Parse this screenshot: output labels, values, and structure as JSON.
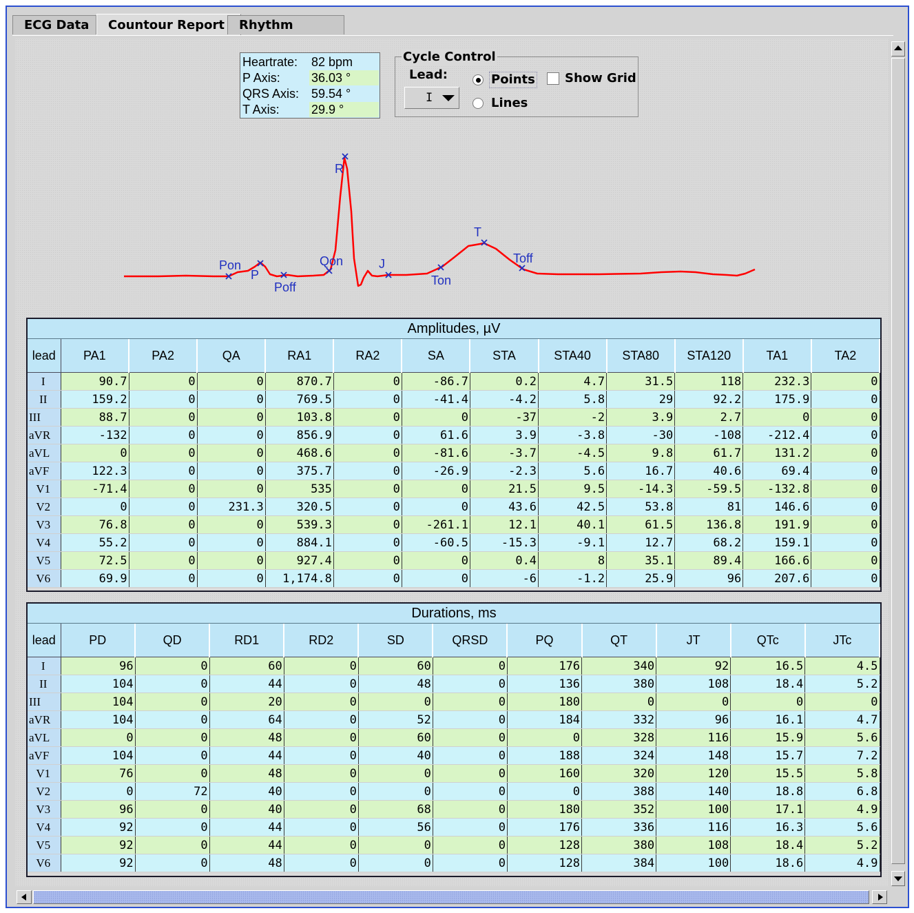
{
  "tabs": [
    {
      "label": "ECG Data",
      "active": false
    },
    {
      "label": "Countour Report",
      "active": true
    },
    {
      "label": "Rhythm Report",
      "active": false
    }
  ],
  "info": [
    {
      "key": "Heartrate:",
      "value": "82 bpm"
    },
    {
      "key": "P Axis:",
      "value": "36.03 °"
    },
    {
      "key": "QRS Axis:",
      "value": "59.54 °"
    },
    {
      "key": "T Axis:",
      "value": "29.9 °"
    }
  ],
  "cycle_control": {
    "title": "Cycle Control",
    "lead_label": "Lead:",
    "lead_value": "I",
    "points_label": "Points",
    "lines_label": "Lines",
    "show_grid_label": "Show Grid",
    "selected": "Points",
    "show_grid": false
  },
  "ecg": {
    "line_color": "#ff0000",
    "marker_color": "#2030c0",
    "markers": [
      "Pon",
      "P",
      "Poff",
      "Qon",
      "R",
      "J",
      "Ton",
      "T",
      "Toff"
    ]
  },
  "amplitudes": {
    "title": "Amplitudes, µV",
    "columns": [
      "lead",
      "PA1",
      "PA2",
      "QA",
      "RA1",
      "RA2",
      "SA",
      "STA",
      "STA40",
      "STA80",
      "STA120",
      "TA1",
      "TA2"
    ],
    "rows": [
      [
        "I",
        "90.7",
        "0",
        "0",
        "870.7",
        "0",
        "-86.7",
        "0.2",
        "4.7",
        "31.5",
        "118",
        "232.3",
        "0"
      ],
      [
        "II",
        "159.2",
        "0",
        "0",
        "769.5",
        "0",
        "-41.4",
        "-4.2",
        "5.8",
        "29",
        "92.2",
        "175.9",
        "0"
      ],
      [
        "III",
        "88.7",
        "0",
        "0",
        "103.8",
        "0",
        "0",
        "-37",
        "-2",
        "3.9",
        "2.7",
        "0",
        "0"
      ],
      [
        "aVR",
        "-132",
        "0",
        "0",
        "856.9",
        "0",
        "61.6",
        "3.9",
        "-3.8",
        "-30",
        "-108",
        "-212.4",
        "0"
      ],
      [
        "aVL",
        "0",
        "0",
        "0",
        "468.6",
        "0",
        "-81.6",
        "-3.7",
        "-4.5",
        "9.8",
        "61.7",
        "131.2",
        "0"
      ],
      [
        "aVF",
        "122.3",
        "0",
        "0",
        "375.7",
        "0",
        "-26.9",
        "-2.3",
        "5.6",
        "16.7",
        "40.6",
        "69.4",
        "0"
      ],
      [
        "V1",
        "-71.4",
        "0",
        "0",
        "535",
        "0",
        "0",
        "21.5",
        "9.5",
        "-14.3",
        "-59.5",
        "-132.8",
        "0"
      ],
      [
        "V2",
        "0",
        "0",
        "231.3",
        "320.5",
        "0",
        "0",
        "43.6",
        "42.5",
        "53.8",
        "81",
        "146.6",
        "0"
      ],
      [
        "V3",
        "76.8",
        "0",
        "0",
        "539.3",
        "0",
        "-261.1",
        "12.1",
        "40.1",
        "61.5",
        "136.8",
        "191.9",
        "0"
      ],
      [
        "V4",
        "55.2",
        "0",
        "0",
        "884.1",
        "0",
        "-60.5",
        "-15.3",
        "-9.1",
        "12.7",
        "68.2",
        "159.1",
        "0"
      ],
      [
        "V5",
        "72.5",
        "0",
        "0",
        "927.4",
        "0",
        "0",
        "0.4",
        "8",
        "35.1",
        "89.4",
        "166.6",
        "0"
      ],
      [
        "V6",
        "69.9",
        "0",
        "0",
        "1,174.8",
        "0",
        "0",
        "-6",
        "-1.2",
        "25.9",
        "96",
        "207.6",
        "0"
      ]
    ]
  },
  "durations": {
    "title": "Durations, ms",
    "columns": [
      "lead",
      "PD",
      "QD",
      "RD1",
      "RD2",
      "SD",
      "QRSD",
      "PQ",
      "QT",
      "JT",
      "QTc",
      "JTc"
    ],
    "rows": [
      [
        "I",
        "96",
        "0",
        "60",
        "0",
        "60",
        "0",
        "176",
        "340",
        "92",
        "16.5",
        "4.5"
      ],
      [
        "II",
        "104",
        "0",
        "44",
        "0",
        "48",
        "0",
        "136",
        "380",
        "108",
        "18.4",
        "5.2"
      ],
      [
        "III",
        "104",
        "0",
        "20",
        "0",
        "0",
        "0",
        "180",
        "0",
        "0",
        "0",
        "0"
      ],
      [
        "aVR",
        "104",
        "0",
        "64",
        "0",
        "52",
        "0",
        "184",
        "332",
        "96",
        "16.1",
        "4.7"
      ],
      [
        "aVL",
        "0",
        "0",
        "48",
        "0",
        "60",
        "0",
        "0",
        "328",
        "116",
        "15.9",
        "5.6"
      ],
      [
        "aVF",
        "104",
        "0",
        "44",
        "0",
        "40",
        "0",
        "188",
        "324",
        "148",
        "15.7",
        "7.2"
      ],
      [
        "V1",
        "76",
        "0",
        "48",
        "0",
        "0",
        "0",
        "160",
        "320",
        "120",
        "15.5",
        "5.8"
      ],
      [
        "V2",
        "0",
        "72",
        "40",
        "0",
        "0",
        "0",
        "0",
        "388",
        "140",
        "18.8",
        "6.8"
      ],
      [
        "V3",
        "96",
        "0",
        "40",
        "0",
        "68",
        "0",
        "180",
        "352",
        "100",
        "17.1",
        "4.9"
      ],
      [
        "V4",
        "92",
        "0",
        "44",
        "0",
        "56",
        "0",
        "176",
        "336",
        "116",
        "16.3",
        "5.6"
      ],
      [
        "V5",
        "92",
        "0",
        "44",
        "0",
        "0",
        "0",
        "128",
        "380",
        "108",
        "18.4",
        "5.2"
      ],
      [
        "V6",
        "92",
        "0",
        "48",
        "0",
        "0",
        "0",
        "128",
        "384",
        "100",
        "18.6",
        "4.9"
      ]
    ]
  }
}
